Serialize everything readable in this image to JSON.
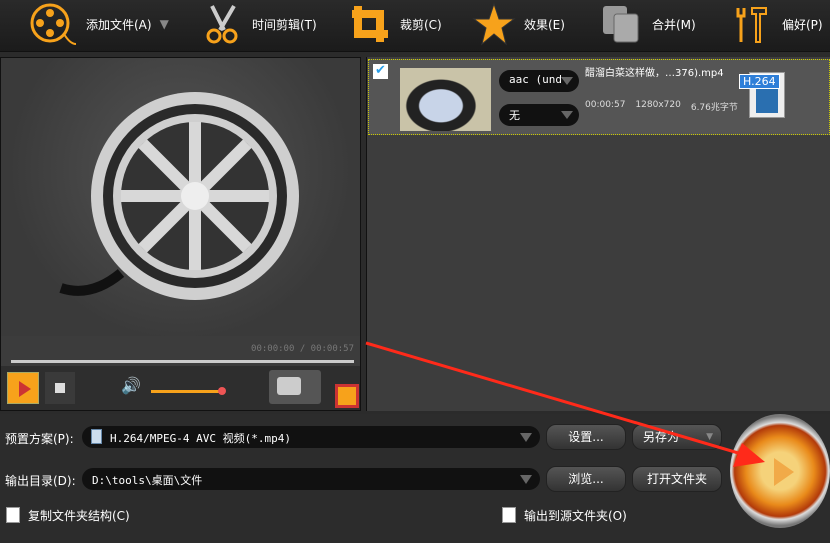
{
  "toolbar": {
    "add_file": "添加文件(A)",
    "trim": "时间剪辑(T)",
    "crop": "裁剪(C)",
    "effect": "效果(E)",
    "merge": "合并(M)",
    "prefs": "偏好(P)"
  },
  "player": {
    "time": "00:00:00 / 00:00:57",
    "volume_percent": 100
  },
  "file": {
    "name": "醋溜白菜这样做，…376).mp4",
    "audio": "aac (und",
    "subtitle": "无",
    "duration": "00:00:57",
    "resolution": "1280x720",
    "size": "6.76兆字节",
    "codec_badge": "H.264",
    "checked": true
  },
  "bottom": {
    "preset_label": "预置方案(P):",
    "preset_value": "H.264/MPEG-4 AVC 视频(*.mp4)",
    "settings": "设置...",
    "save_as": "另存为",
    "output_label": "输出目录(D):",
    "output_value": "D:\\tools\\桌面\\文件",
    "browse": "浏览...",
    "open_folder": "打开文件夹",
    "copy_structure": "复制文件夹结构(C)",
    "output_to_source": "输出到源文件夹(O)"
  },
  "colors": {
    "accent": "#f7a21b",
    "arrow": "#ff2a1a"
  }
}
